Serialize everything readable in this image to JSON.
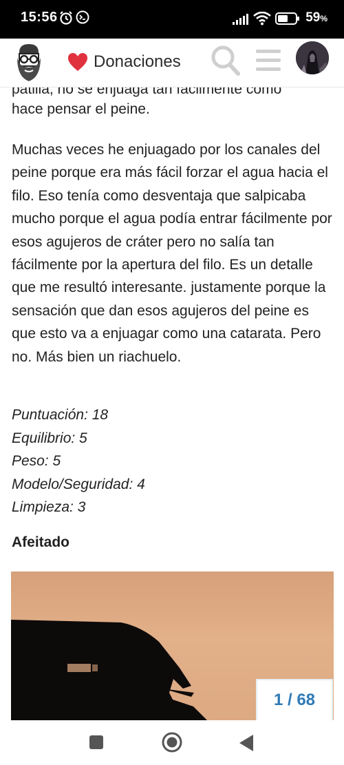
{
  "status_bar": {
    "time": "15:56",
    "battery_percent": "59",
    "battery_symbol": "%",
    "icons": [
      "alarm-icon",
      "terminal-icon",
      "signal-icon",
      "wifi-icon",
      "battery-icon"
    ]
  },
  "header": {
    "logo_icon": "bearded-man-logo",
    "donate_label": "Donaciones",
    "donate_icon": "heart-icon",
    "search_icon": "search-icon",
    "menu_icon": "hamburger-menu-icon",
    "avatar_icon": "avatar"
  },
  "article": {
    "cut_off_line": "patilla, no se enjuaga tan fácilmente como",
    "paragraph_end": "hace pensar el peine.",
    "paragraph": "Muchas veces he enjuagado por los canales del peine porque era más fácil forzar el agua hacia el filo. Eso tenía como desventaja que salpicaba mucho porque el agua podía entrar fácilmente por esos agujeros de cráter pero no salía tan fácilmente por la apertura del filo. Es un detalle que me resultó interesante. justamente porque la sensación que dan esos agujeros del peine es que esto va a enjuagar como una catarata. Pero no. Más bien un riachuelo.",
    "scores": [
      "Puntuación: 18",
      "Equilibrio: 5",
      "Peso: 5",
      "Modelo/Seguridad: 4",
      "Limpieza: 3"
    ],
    "section_title": "Afeitado",
    "gallery_counter": "1 / 68"
  },
  "colors": {
    "accent": "#2f7ab6",
    "heart": "#e0313f",
    "icon_gray": "#cfcfcf"
  },
  "nav_bar": {
    "icons": [
      "recent-apps-icon",
      "home-icon",
      "back-icon"
    ]
  }
}
